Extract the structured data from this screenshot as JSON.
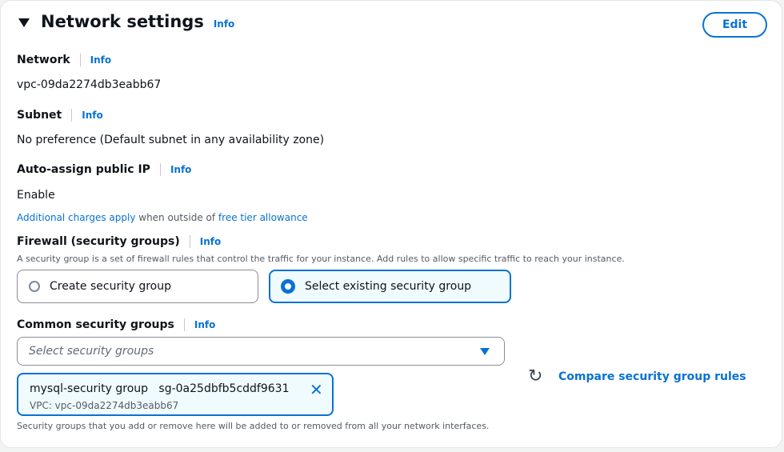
{
  "header": {
    "title": "Network settings",
    "info": "Info",
    "edit_label": "Edit"
  },
  "network": {
    "label": "Network",
    "info": "Info",
    "value": "vpc-09da2274db3eabb67"
  },
  "subnet": {
    "label": "Subnet",
    "info": "Info",
    "value": "No preference (Default subnet in any availability zone)"
  },
  "auto_ip": {
    "label": "Auto-assign public IP",
    "info": "Info",
    "value": "Enable",
    "note_link1": "Additional charges apply",
    "note_mid": " when outside of ",
    "note_link2": "free tier allowance"
  },
  "firewall": {
    "label": "Firewall (security groups)",
    "info": "Info",
    "description": "A security group is a set of firewall rules that control the traffic for your instance. Add rules to allow specific traffic to reach your instance.",
    "options": [
      {
        "label": "Create security group",
        "selected": false
      },
      {
        "label": "Select existing security group",
        "selected": true
      }
    ]
  },
  "common_sg": {
    "label": "Common security groups",
    "info": "Info",
    "placeholder": "Select security groups",
    "token": {
      "name": "mysql-security group",
      "id": "sg-0a25dbfb5cddf9631",
      "vpc": "VPC: vpc-09da2274db3eabb67"
    },
    "compare_label": "Compare security group rules",
    "footer": "Security groups that you add or remove here will be added to or removed from all your network interfaces."
  },
  "colors": {
    "accent": "#0972d3",
    "selected_bg": "#f0fbff"
  }
}
